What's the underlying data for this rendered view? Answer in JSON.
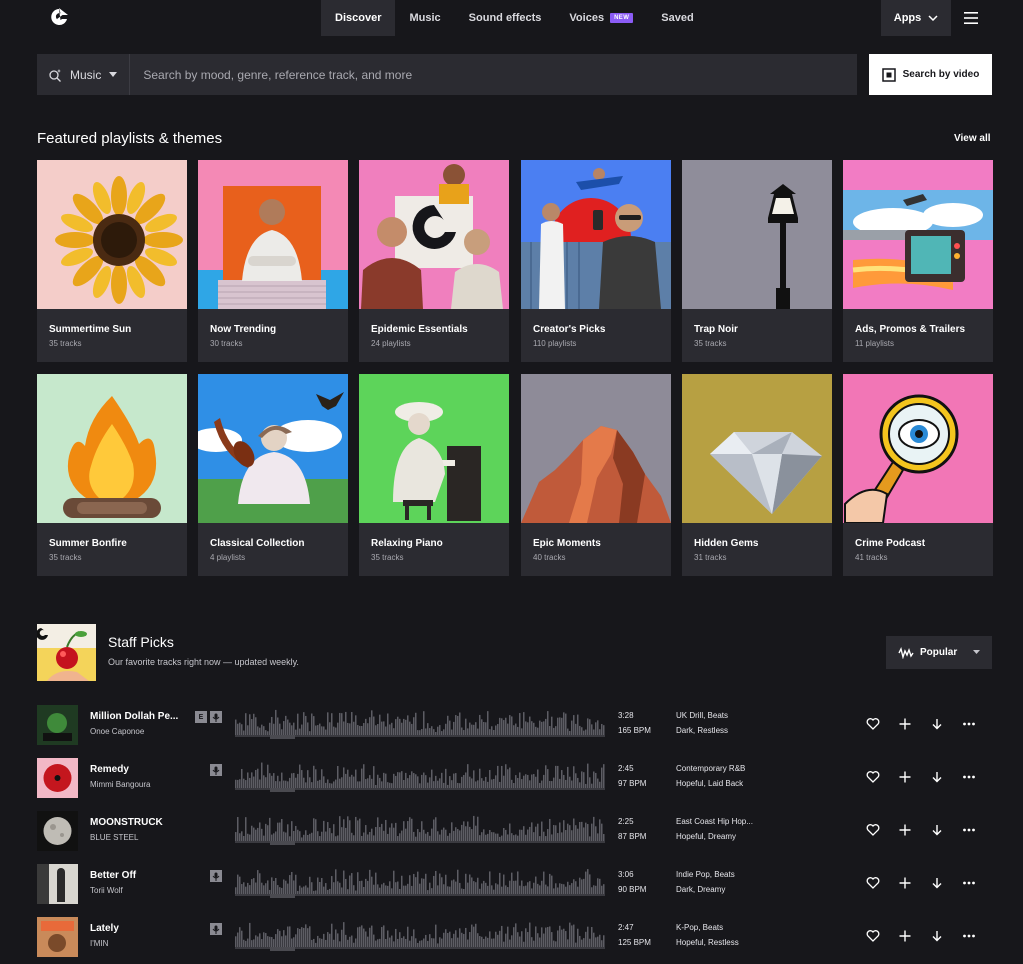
{
  "nav": {
    "tabs": [
      {
        "label": "Discover"
      },
      {
        "label": "Music"
      },
      {
        "label": "Sound effects"
      },
      {
        "label": "Voices",
        "badge": "NEW"
      },
      {
        "label": "Saved"
      }
    ],
    "apps_label": "Apps"
  },
  "search": {
    "type_label": "Music",
    "placeholder": "Search by mood, genre, reference track, and more",
    "video_button": "Search by video"
  },
  "featured": {
    "title": "Featured playlists & themes",
    "view_all": "View all",
    "cards": [
      {
        "title": "Summertime Sun",
        "subtitle": "35 tracks"
      },
      {
        "title": "Now Trending",
        "subtitle": "30 tracks"
      },
      {
        "title": "Epidemic Essentials",
        "subtitle": "24 playlists"
      },
      {
        "title": "Creator's Picks",
        "subtitle": "110 playlists"
      },
      {
        "title": "Trap Noir",
        "subtitle": "35 tracks"
      },
      {
        "title": "Ads, Promos & Trailers",
        "subtitle": "11 playlists"
      },
      {
        "title": "Summer Bonfire",
        "subtitle": "35 tracks"
      },
      {
        "title": "Classical Collection",
        "subtitle": "4 playlists"
      },
      {
        "title": "Relaxing Piano",
        "subtitle": "35 tracks"
      },
      {
        "title": "Epic Moments",
        "subtitle": "40 tracks"
      },
      {
        "title": "Hidden Gems",
        "subtitle": "31 tracks"
      },
      {
        "title": "Crime Podcast",
        "subtitle": "41 tracks"
      }
    ]
  },
  "staff_picks": {
    "title": "Staff Picks",
    "subtitle": "Our favorite tracks right now — updated weekly.",
    "sort_label": "Popular",
    "tracks": [
      {
        "title": "Million Dollah Pe...",
        "artist": "Onoe Caponoe",
        "duration": "3:28",
        "bpm": "165 BPM",
        "genres": "UK Drill, Beats",
        "moods": "Dark, Restless",
        "explicit": "E"
      },
      {
        "title": "Remedy",
        "artist": "Mimmi Bangoura",
        "duration": "2:45",
        "bpm": "97 BPM",
        "genres": "Contemporary R&B",
        "moods": "Hopeful, Laid Back"
      },
      {
        "title": "MOONSTRUCK",
        "artist": "BLUE STEEL",
        "duration": "2:25",
        "bpm": "87 BPM",
        "genres": "East Coast Hip Hop...",
        "moods": "Hopeful, Dreamy"
      },
      {
        "title": "Better Off",
        "artist": "Torii Wolf",
        "duration": "3:06",
        "bpm": "90 BPM",
        "genres": "Indie Pop, Beats",
        "moods": "Dark, Dreamy"
      },
      {
        "title": "Lately",
        "artist": "I'MIN",
        "duration": "2:47",
        "bpm": "125 BPM",
        "genres": "K-Pop, Beats",
        "moods": "Hopeful, Restless"
      }
    ]
  },
  "colors": {
    "background": "#17171b",
    "surface": "#2b2b31",
    "new_badge": "#8b5cf6"
  }
}
